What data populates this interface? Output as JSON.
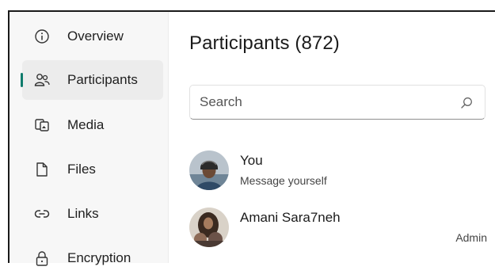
{
  "sidebar": {
    "items": [
      {
        "label": "Overview",
        "icon": "info-icon",
        "selected": false
      },
      {
        "label": "Participants",
        "icon": "people-icon",
        "selected": true
      },
      {
        "label": "Media",
        "icon": "media-icon",
        "selected": false
      },
      {
        "label": "Files",
        "icon": "file-icon",
        "selected": false
      },
      {
        "label": "Links",
        "icon": "link-icon",
        "selected": false
      },
      {
        "label": "Encryption",
        "icon": "lock-icon",
        "selected": false
      }
    ]
  },
  "main": {
    "title": "Participants (872)",
    "search": {
      "placeholder": "Search",
      "value": ""
    },
    "participants": [
      {
        "name": "You",
        "subtitle": "Message yourself",
        "role": ""
      },
      {
        "name": "Amani Sara7neh",
        "subtitle": "",
        "role": "Admin"
      }
    ]
  },
  "colors": {
    "accent": "#0f7b6c",
    "sidebar_bg": "#f7f7f7",
    "selected_bg": "#ececec"
  }
}
